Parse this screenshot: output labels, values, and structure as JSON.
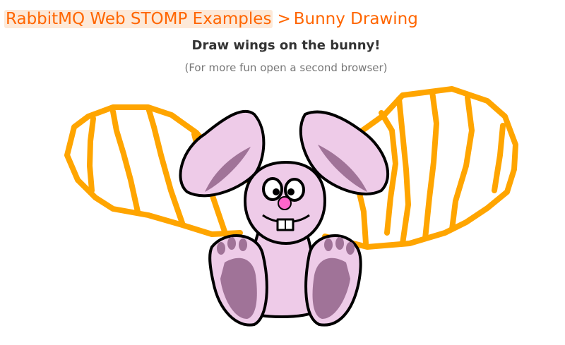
{
  "breadcrumb": {
    "parent_label": "RabbitMQ Web STOMP Examples",
    "separator": ">",
    "current_label": "Bunny Drawing"
  },
  "heading": "Draw wings on the bunny!",
  "subtitle": "(For more fun open a second browser)",
  "colors": {
    "accent": "#ff6600",
    "crumb_background": "#fde9d8",
    "wing_stroke": "#ffa500",
    "bunny_fill": "#eecbe8",
    "bunny_shade": "#a07398",
    "nose": "#ff66cc"
  }
}
